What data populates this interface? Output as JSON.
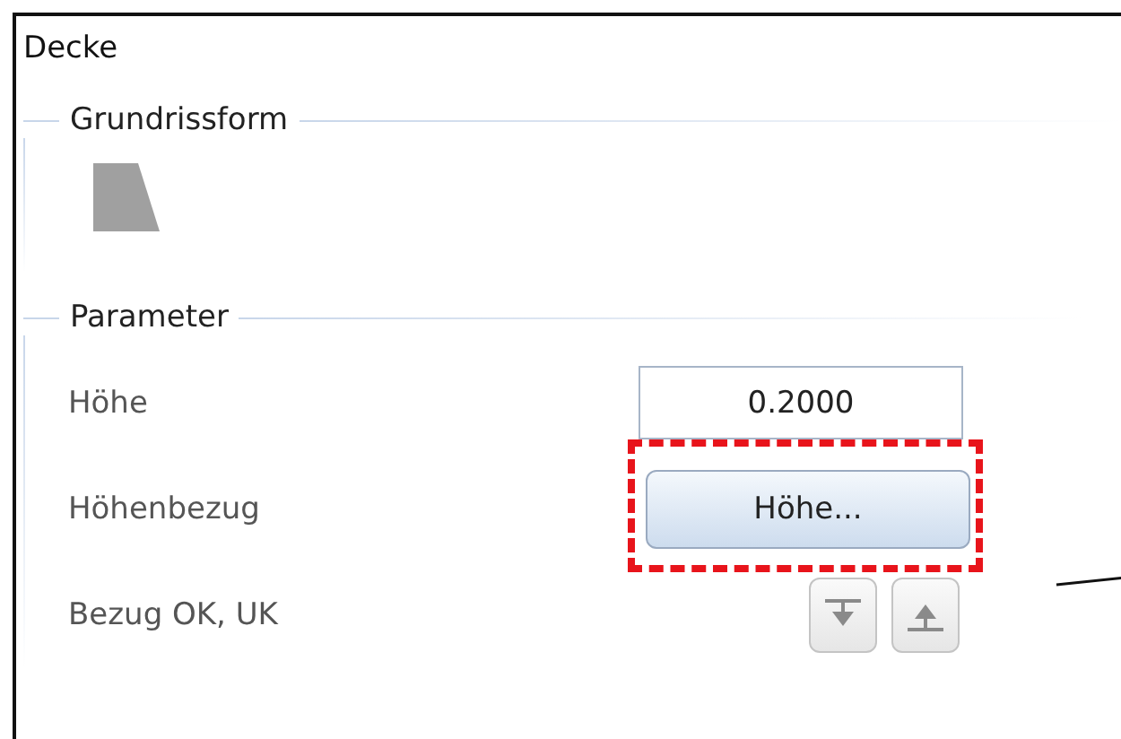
{
  "panel": {
    "title": "Decke"
  },
  "groups": [
    {
      "legend": "Grundrissform",
      "kind": "shape"
    },
    {
      "legend": "Parameter",
      "kind": "params",
      "rows": [
        {
          "label": "Höhe",
          "kind": "field",
          "value": "0.2000"
        },
        {
          "label": "Höhenbezug",
          "kind": "button",
          "text": "Höhe...",
          "highlighted": true
        },
        {
          "label": "Bezug OK, UK",
          "kind": "toggles"
        }
      ]
    }
  ]
}
